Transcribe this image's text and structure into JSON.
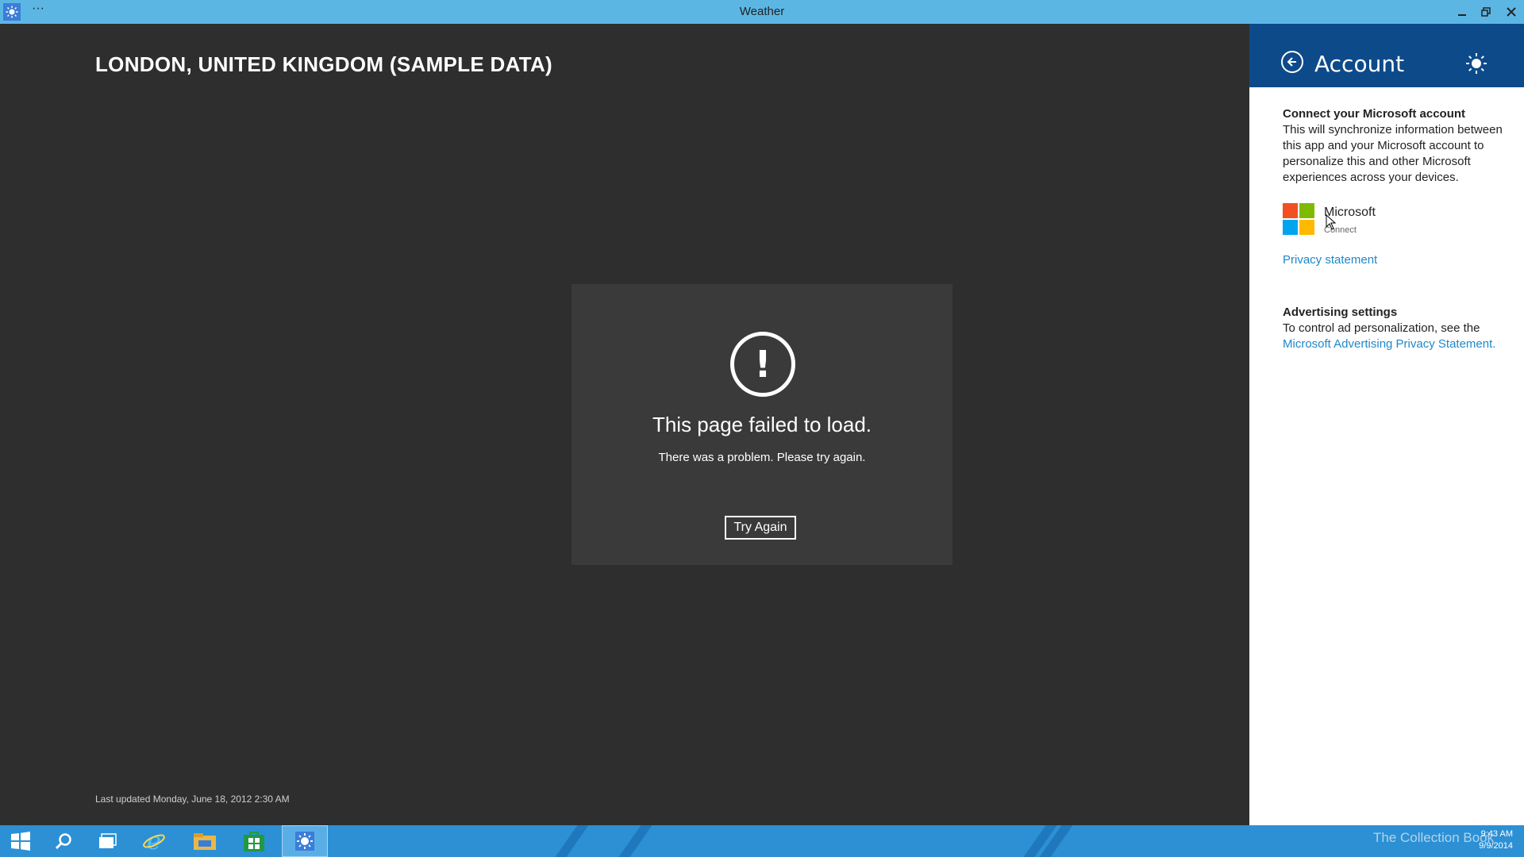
{
  "window": {
    "title": "Weather",
    "menu_glyph": "···"
  },
  "main": {
    "location": "LONDON, UNITED KINGDOM (SAMPLE DATA)",
    "error": {
      "icon": "exclamation-icon",
      "title": "This page failed to load.",
      "message": "There was a problem. Please try again.",
      "button": "Try Again"
    },
    "last_updated": "Last updated Monday, June 18, 2012 2:30 AM"
  },
  "account_pane": {
    "title": "Account",
    "connect_heading": "Connect your Microsoft account",
    "connect_text": "This will synchronize information between this app and your Microsoft account to personalize this and other Microsoft experiences across your devices.",
    "provider_name": "Microsoft",
    "provider_action": "Connect",
    "privacy_link": "Privacy statement",
    "ad_heading": "Advertising settings",
    "ad_text": "To control ad personalization, see the",
    "ad_link": "Microsoft Advertising Privacy Statement."
  },
  "taskbar": {
    "items": [
      "start-icon",
      "search-icon",
      "task-view-icon",
      "internet-explorer-icon",
      "file-explorer-icon",
      "store-icon",
      "weather-icon"
    ],
    "watermark": "The Collection Book",
    "time": "9:43 AM",
    "date": "9/9/2014"
  },
  "colors": {
    "titlebar": "#5cb6e4",
    "app_background": "#2e2e2e",
    "card_background": "#3a3a3a",
    "pane_header": "#0d4a8a",
    "link": "#1e88c9",
    "taskbar": "#2d90d4"
  }
}
